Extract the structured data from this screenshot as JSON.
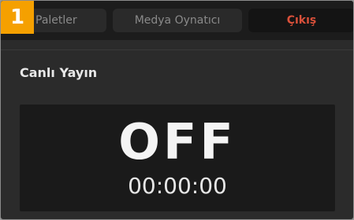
{
  "badge": {
    "number": "1"
  },
  "tabs": [
    {
      "label": "Paletler"
    },
    {
      "label": "Medya Oynatıcı"
    },
    {
      "label": "Çıkış",
      "active": true
    }
  ],
  "section": {
    "title": "Canlı Yayın"
  },
  "stream": {
    "status": "OFF",
    "timecode": "00:00:00"
  },
  "colors": {
    "accent_badge": "#f5a000",
    "active_tab_text": "#d9503a",
    "panel_bg": "#2b2b2b",
    "display_bg": "#1a1a1a"
  }
}
